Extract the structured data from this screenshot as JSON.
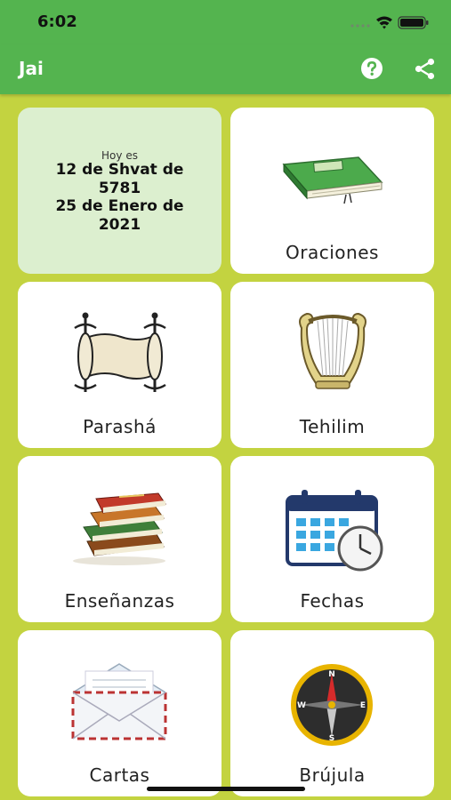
{
  "status_bar": {
    "time": "6:02"
  },
  "app_bar": {
    "title": "Jai",
    "help_icon": "help-circle-icon",
    "share_icon": "share-icon"
  },
  "today_card": {
    "caption": "Hoy es",
    "hebrew_date_line1": "12 de Shvat de",
    "hebrew_date_line2": "5781",
    "gregorian_date_line1": "25 de Enero de",
    "gregorian_date_line2": "2021"
  },
  "menu": {
    "oraciones": {
      "label": "Oraciones",
      "icon": "prayer-book-icon"
    },
    "parasha": {
      "label": "Parashá",
      "icon": "torah-scroll-icon"
    },
    "tehilim": {
      "label": "Tehilim",
      "icon": "lyre-icon"
    },
    "ensenanzas": {
      "label": "Enseñanzas",
      "icon": "books-stack-icon"
    },
    "fechas": {
      "label": "Fechas",
      "icon": "calendar-clock-icon"
    },
    "cartas": {
      "label": "Cartas",
      "icon": "envelope-icon"
    },
    "brujula": {
      "label": "Brújula",
      "icon": "compass-icon"
    }
  },
  "colors": {
    "background": "#c3d340",
    "app_bar": "#54b44f",
    "today_card": "#dcefcf"
  }
}
